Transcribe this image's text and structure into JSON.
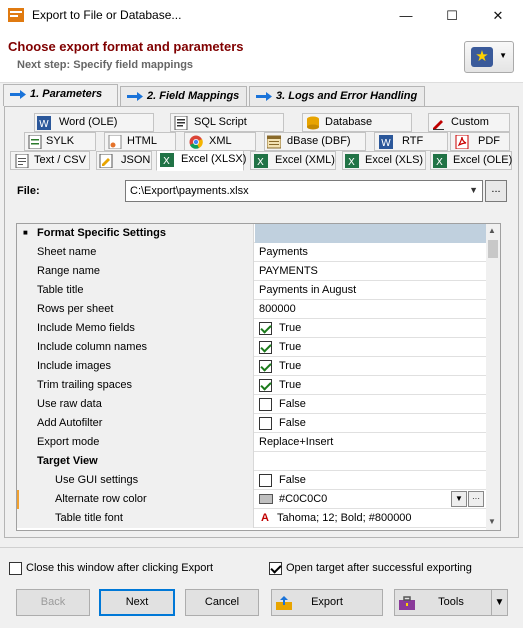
{
  "window": {
    "title": "Export to File or Database...",
    "min": "—",
    "max": "☐",
    "close": "✕"
  },
  "header": {
    "title": "Choose export format and parameters",
    "subtitle": "Next step: Specify field mappings"
  },
  "wizard_tabs": [
    "1. Parameters",
    "2. Field Mappings",
    "3. Logs and Error Handling"
  ],
  "format_tabs": {
    "row1": [
      "Word (OLE)",
      "SQL Script",
      "Database",
      "Custom"
    ],
    "row2": [
      "SYLK",
      "HTML",
      "XML",
      "dBase (DBF)",
      "RTF",
      "PDF"
    ],
    "row3": [
      "Text / CSV",
      "JSON",
      "Excel (XLSX)",
      "Excel (XML)",
      "Excel (XLS)",
      "Excel (OLE)"
    ]
  },
  "file": {
    "label": "File:",
    "value": "C:\\Export\\payments.xlsx",
    "browse": "..."
  },
  "grid": {
    "section": "Format Specific Settings",
    "rows": [
      {
        "name": "Sheet name",
        "value": "Payments"
      },
      {
        "name": "Range name",
        "value": "PAYMENTS"
      },
      {
        "name": "Table title",
        "value": "Payments in August"
      },
      {
        "name": "Rows per sheet",
        "value": "800000"
      },
      {
        "name": "Include Memo fields",
        "value": "True"
      },
      {
        "name": "Include column names",
        "value": "True"
      },
      {
        "name": "Include images",
        "value": "True"
      },
      {
        "name": "Trim trailing spaces",
        "value": "True"
      },
      {
        "name": "Use raw data",
        "value": "False"
      },
      {
        "name": "Add Autofilter",
        "value": "False"
      },
      {
        "name": "Export mode",
        "value": "Replace+Insert"
      },
      {
        "name": "Target View",
        "value": ""
      },
      {
        "name": "Use GUI settings",
        "value": "False"
      },
      {
        "name": "Alternate row color",
        "value": "#C0C0C0"
      },
      {
        "name": "Table title font",
        "value": "Tahoma; 12; Bold; #800000",
        "font_letter": "A"
      }
    ]
  },
  "options": {
    "close_after_export": "Close this window after clicking Export",
    "open_target": "Open target after successful exporting"
  },
  "buttons": {
    "back": "Back",
    "next": "Next",
    "cancel": "Cancel",
    "export": "Export",
    "tools": "Tools"
  },
  "colors": {
    "accent": "#800000",
    "header_cell": "#c0d0de",
    "selection_marker": "#f0a030",
    "arrow_blue": "#1a73d9"
  }
}
